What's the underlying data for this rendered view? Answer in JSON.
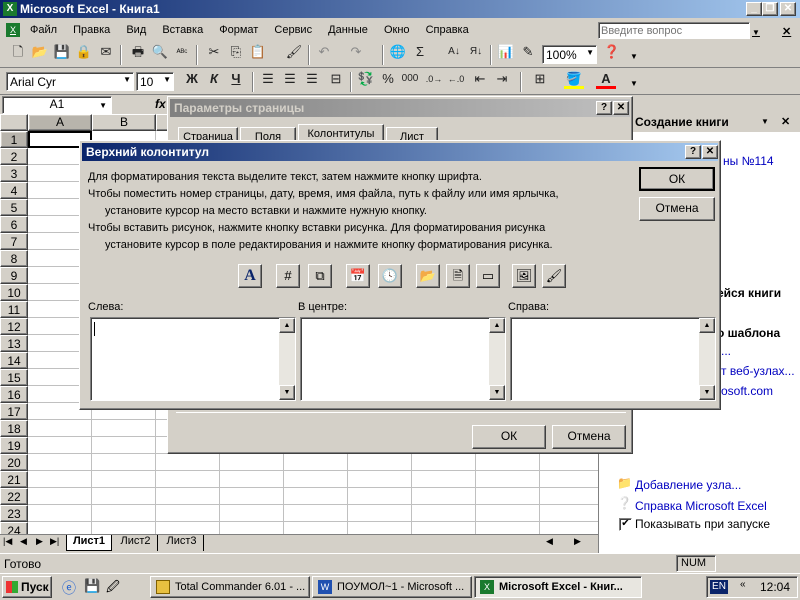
{
  "app": {
    "title": "Microsoft Excel - Книга1",
    "help_placeholder": "Введите вопрос"
  },
  "menu": [
    "Файл",
    "Правка",
    "Вид",
    "Вставка",
    "Формат",
    "Сервис",
    "Данные",
    "Окно",
    "Справка"
  ],
  "toolbar": {
    "zoom": "100%",
    "font": "Arial Cyr",
    "size": "10",
    "bold": "Ж",
    "italic": "К",
    "underline": "Ч",
    "sum": "Σ",
    "percent": "%",
    "thousands": "000"
  },
  "formula": {
    "cell_ref": "A1",
    "fx": "fx"
  },
  "columns": [
    "A",
    "B"
  ],
  "rows": [
    "1",
    "2",
    "3",
    "4",
    "5",
    "6",
    "7",
    "8",
    "9",
    "10",
    "11",
    "12",
    "13",
    "14",
    "15",
    "16",
    "17",
    "18",
    "19",
    "20",
    "21",
    "22",
    "23",
    "24"
  ],
  "sheets": [
    "Лист1",
    "Лист2",
    "Лист3"
  ],
  "status": {
    "text": "Готово",
    "num": "NUM"
  },
  "taskpane": {
    "title": "Создание книги",
    "frag1": "ны №114",
    "frag2": "ейся книги",
    "frag3": "о шаблона",
    "frag4": "...",
    "frag5": "т веб-узлах...",
    "frag6": "osoft.com",
    "add_node": "Добавление узла...",
    "help": "Справка Microsoft Excel",
    "show_start": "Показывать при запуске"
  },
  "page_setup": {
    "title": "Параметры страницы",
    "tabs": [
      "Страница",
      "Поля",
      "Колонтитулы",
      "Лист"
    ],
    "ok": "ОК",
    "cancel": "Отмена"
  },
  "header_dialog": {
    "title": "Верхний колонтитул",
    "line1": "Для форматирования текста выделите текст, затем  нажмите кнопку шрифта.",
    "line2": "Чтобы поместить номер страницы, дату, время, имя файла, путь к файлу или имя ярлычка,",
    "line3": "установите курсор на место вставки и нажмите нужную кнопку.",
    "line4": "Чтобы вставить рисунок, нажмите кнопку вставки рисунка.  Для форматирования рисунка",
    "line5": "установите курсор в поле редактирования и нажмите кнопку форматирования рисунка.",
    "ok": "ОК",
    "cancel": "Отмена",
    "left_label": "Слева:",
    "center_label": "В центре:",
    "right_label": "Справа:",
    "btn_font": "A",
    "left_value": "",
    "center_value": "",
    "right_value": ""
  },
  "taskbar": {
    "start": "Пуск",
    "items": [
      "Total Commander 6.01 - ...",
      "ПОУМОЛ~1 - Microsoft ...",
      "Microsoft Excel - Книг..."
    ],
    "lang": "EN",
    "time": "12:04"
  },
  "colors": {
    "title_active": "#0a246a",
    "title_gradient_end": "#a6caf0",
    "face": "#d4d0c8",
    "link": "#0000c0"
  }
}
